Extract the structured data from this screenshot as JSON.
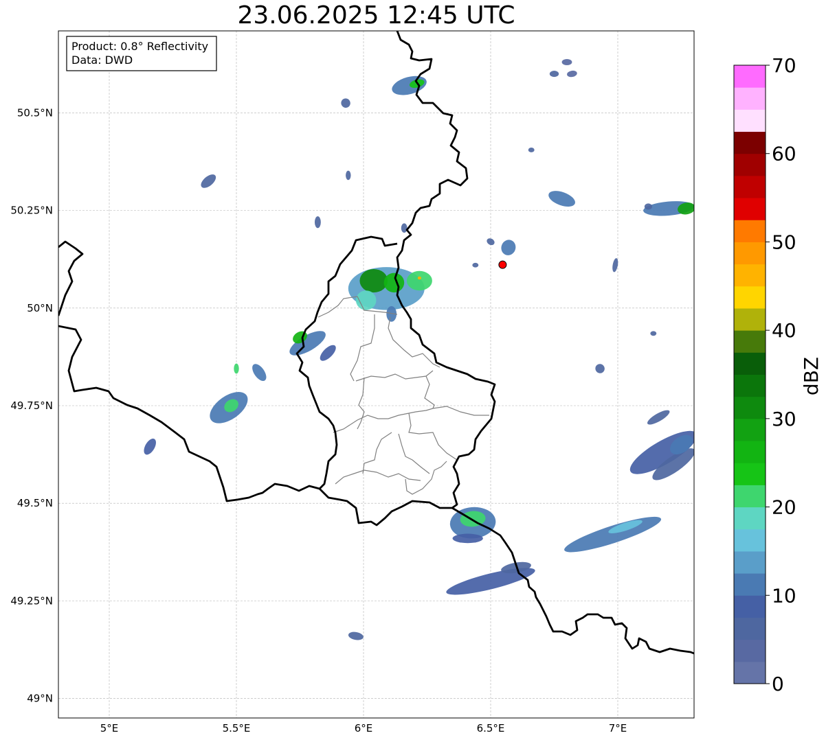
{
  "title": "23.06.2025 12:45 UTC",
  "info_box": {
    "product": "Product: 0.8° Reflectivity",
    "source": "Data: DWD"
  },
  "axes": {
    "lon_range": [
      4.8,
      7.3
    ],
    "lat_range": [
      48.95,
      50.71
    ],
    "lon_ticks": [
      {
        "value": 5.0,
        "label": "5°E"
      },
      {
        "value": 5.5,
        "label": "5.5°E"
      },
      {
        "value": 6.0,
        "label": "6°E"
      },
      {
        "value": 6.5,
        "label": "6.5°E"
      },
      {
        "value": 7.0,
        "label": "7°E"
      }
    ],
    "lat_ticks": [
      {
        "value": 49.0,
        "label": "49°N"
      },
      {
        "value": 49.25,
        "label": "49.25°N"
      },
      {
        "value": 49.5,
        "label": "49.5°N"
      },
      {
        "value": 49.75,
        "label": "49.75°N"
      },
      {
        "value": 50.0,
        "label": "50°N"
      },
      {
        "value": 50.25,
        "label": "50.25°N"
      },
      {
        "value": 50.5,
        "label": "50.5°N"
      }
    ],
    "grid": true
  },
  "colorbar": {
    "title": "dBZ",
    "min": 0,
    "max": 70,
    "step": 2.5,
    "labels": [
      "0",
      "10",
      "20",
      "30",
      "40",
      "50",
      "60",
      "70"
    ],
    "colors": [
      "#6574a8",
      "#5869a2",
      "#4e67a0",
      "#4560a5",
      "#4a7ab3",
      "#5a9ec9",
      "#67c2dc",
      "#5ed6c2",
      "#3ed66e",
      "#16c416",
      "#12b412",
      "#12a212",
      "#0e8a0e",
      "#0b760b",
      "#095e09",
      "#477a0a",
      "#b0b20a",
      "#ffd500",
      "#ffb300",
      "#ff9900",
      "#ff7a00",
      "#e00000",
      "#c00000",
      "#a00000",
      "#7c0000",
      "#ffe0ff",
      "#ffb2ff",
      "#ff6bff",
      "#ea35ea"
    ]
  },
  "marker": {
    "name": "radar-site",
    "lon": 6.547,
    "lat": 50.111,
    "color": "#ff0000"
  },
  "echo_cells": [
    {
      "lon": 6.18,
      "lat": 50.57,
      "rx": 0.07,
      "ry": 0.022,
      "rot": -15,
      "dbz": 12
    },
    {
      "lon": 6.21,
      "lat": 50.575,
      "rx": 0.03,
      "ry": 0.01,
      "rot": -15,
      "dbz": 24
    },
    {
      "lon": 5.93,
      "lat": 50.525,
      "rx": 0.018,
      "ry": 0.012,
      "rot": -30,
      "dbz": 6
    },
    {
      "lon": 6.8,
      "lat": 50.63,
      "rx": 0.02,
      "ry": 0.008,
      "rot": 0,
      "dbz": 4
    },
    {
      "lon": 6.75,
      "lat": 50.6,
      "rx": 0.018,
      "ry": 0.008,
      "rot": 0,
      "dbz": 5
    },
    {
      "lon": 6.82,
      "lat": 50.6,
      "rx": 0.02,
      "ry": 0.008,
      "rot": -10,
      "dbz": 4
    },
    {
      "lon": 6.66,
      "lat": 50.405,
      "rx": 0.012,
      "ry": 0.006,
      "rot": 0,
      "dbz": 5
    },
    {
      "lon": 5.39,
      "lat": 50.325,
      "rx": 0.035,
      "ry": 0.012,
      "rot": -40,
      "dbz": 6
    },
    {
      "lon": 5.94,
      "lat": 50.34,
      "rx": 0.01,
      "ry": 0.012,
      "rot": 0,
      "dbz": 6
    },
    {
      "lon": 6.78,
      "lat": 50.28,
      "rx": 0.055,
      "ry": 0.017,
      "rot": 20,
      "dbz": 10
    },
    {
      "lon": 7.2,
      "lat": 50.255,
      "rx": 0.1,
      "ry": 0.018,
      "rot": -5,
      "dbz": 10
    },
    {
      "lon": 7.27,
      "lat": 50.255,
      "rx": 0.035,
      "ry": 0.015,
      "rot": -10,
      "dbz": 28
    },
    {
      "lon": 7.12,
      "lat": 50.26,
      "rx": 0.015,
      "ry": 0.008,
      "rot": 0,
      "dbz": 5
    },
    {
      "lon": 5.82,
      "lat": 50.22,
      "rx": 0.012,
      "ry": 0.015,
      "rot": 0,
      "dbz": 6
    },
    {
      "lon": 6.16,
      "lat": 50.205,
      "rx": 0.012,
      "ry": 0.012,
      "rot": 0,
      "dbz": 6
    },
    {
      "lon": 6.57,
      "lat": 50.155,
      "rx": 0.028,
      "ry": 0.02,
      "rot": 20,
      "dbz": 10
    },
    {
      "lon": 6.5,
      "lat": 50.17,
      "rx": 0.016,
      "ry": 0.008,
      "rot": 30,
      "dbz": 5
    },
    {
      "lon": 6.44,
      "lat": 50.11,
      "rx": 0.012,
      "ry": 0.006,
      "rot": 0,
      "dbz": 5
    },
    {
      "lon": 6.99,
      "lat": 50.11,
      "rx": 0.01,
      "ry": 0.018,
      "rot": 10,
      "dbz": 5
    },
    {
      "lon": 6.09,
      "lat": 50.05,
      "rx": 0.15,
      "ry": 0.055,
      "rot": 0,
      "dbz": 14
    },
    {
      "lon": 6.04,
      "lat": 50.07,
      "rx": 0.055,
      "ry": 0.03,
      "rot": 0,
      "dbz": 30
    },
    {
      "lon": 6.12,
      "lat": 50.065,
      "rx": 0.04,
      "ry": 0.025,
      "rot": 0,
      "dbz": 26
    },
    {
      "lon": 6.22,
      "lat": 50.07,
      "rx": 0.05,
      "ry": 0.025,
      "rot": 0,
      "dbz": 22
    },
    {
      "lon": 6.01,
      "lat": 50.02,
      "rx": 0.04,
      "ry": 0.025,
      "rot": 0,
      "dbz": 18
    },
    {
      "lon": 6.11,
      "lat": 49.985,
      "rx": 0.02,
      "ry": 0.02,
      "rot": 0,
      "dbz": 10
    },
    {
      "lon": 6.22,
      "lat": 50.077,
      "rx": 0.007,
      "ry": 0.004,
      "rot": 0,
      "dbz": 46
    },
    {
      "lon": 5.78,
      "lat": 49.91,
      "rx": 0.08,
      "ry": 0.02,
      "rot": -30,
      "dbz": 12
    },
    {
      "lon": 5.75,
      "lat": 49.925,
      "rx": 0.03,
      "ry": 0.014,
      "rot": -30,
      "dbz": 26
    },
    {
      "lon": 5.86,
      "lat": 49.885,
      "rx": 0.04,
      "ry": 0.012,
      "rot": -45,
      "dbz": 8
    },
    {
      "lon": 5.5,
      "lat": 49.845,
      "rx": 0.01,
      "ry": 0.013,
      "rot": 0,
      "dbz": 20
    },
    {
      "lon": 5.59,
      "lat": 49.835,
      "rx": 0.02,
      "ry": 0.025,
      "rot": -35,
      "dbz": 12
    },
    {
      "lon": 5.47,
      "lat": 49.745,
      "rx": 0.085,
      "ry": 0.03,
      "rot": -35,
      "dbz": 12
    },
    {
      "lon": 5.48,
      "lat": 49.75,
      "rx": 0.03,
      "ry": 0.015,
      "rot": -35,
      "dbz": 22
    },
    {
      "lon": 5.16,
      "lat": 49.645,
      "rx": 0.035,
      "ry": 0.012,
      "rot": -60,
      "dbz": 8
    },
    {
      "lon": 6.93,
      "lat": 49.845,
      "rx": 0.018,
      "ry": 0.012,
      "rot": -40,
      "dbz": 6
    },
    {
      "lon": 7.14,
      "lat": 49.935,
      "rx": 0.012,
      "ry": 0.006,
      "rot": 0,
      "dbz": 5
    },
    {
      "lon": 7.16,
      "lat": 49.72,
      "rx": 0.05,
      "ry": 0.01,
      "rot": -30,
      "dbz": 6
    },
    {
      "lon": 7.18,
      "lat": 49.63,
      "rx": 0.15,
      "ry": 0.03,
      "rot": -30,
      "dbz": 8
    },
    {
      "lon": 7.22,
      "lat": 49.6,
      "rx": 0.1,
      "ry": 0.02,
      "rot": -35,
      "dbz": 6
    },
    {
      "lon": 7.25,
      "lat": 49.65,
      "rx": 0.05,
      "ry": 0.02,
      "rot": -35,
      "dbz": 10
    },
    {
      "lon": 6.98,
      "lat": 49.42,
      "rx": 0.2,
      "ry": 0.022,
      "rot": -18,
      "dbz": 10
    },
    {
      "lon": 7.03,
      "lat": 49.44,
      "rx": 0.07,
      "ry": 0.01,
      "rot": -18,
      "dbz": 16
    },
    {
      "lon": 6.43,
      "lat": 49.45,
      "rx": 0.09,
      "ry": 0.04,
      "rot": -5,
      "dbz": 10
    },
    {
      "lon": 6.43,
      "lat": 49.46,
      "rx": 0.05,
      "ry": 0.02,
      "rot": -5,
      "dbz": 20
    },
    {
      "lon": 6.41,
      "lat": 49.41,
      "rx": 0.06,
      "ry": 0.012,
      "rot": 0,
      "dbz": 8
    },
    {
      "lon": 6.5,
      "lat": 49.3,
      "rx": 0.18,
      "ry": 0.02,
      "rot": -14,
      "dbz": 8
    },
    {
      "lon": 6.6,
      "lat": 49.335,
      "rx": 0.06,
      "ry": 0.013,
      "rot": -10,
      "dbz": 6
    },
    {
      "lon": 5.97,
      "lat": 49.16,
      "rx": 0.03,
      "ry": 0.01,
      "rot": 10,
      "dbz": 6
    }
  ]
}
